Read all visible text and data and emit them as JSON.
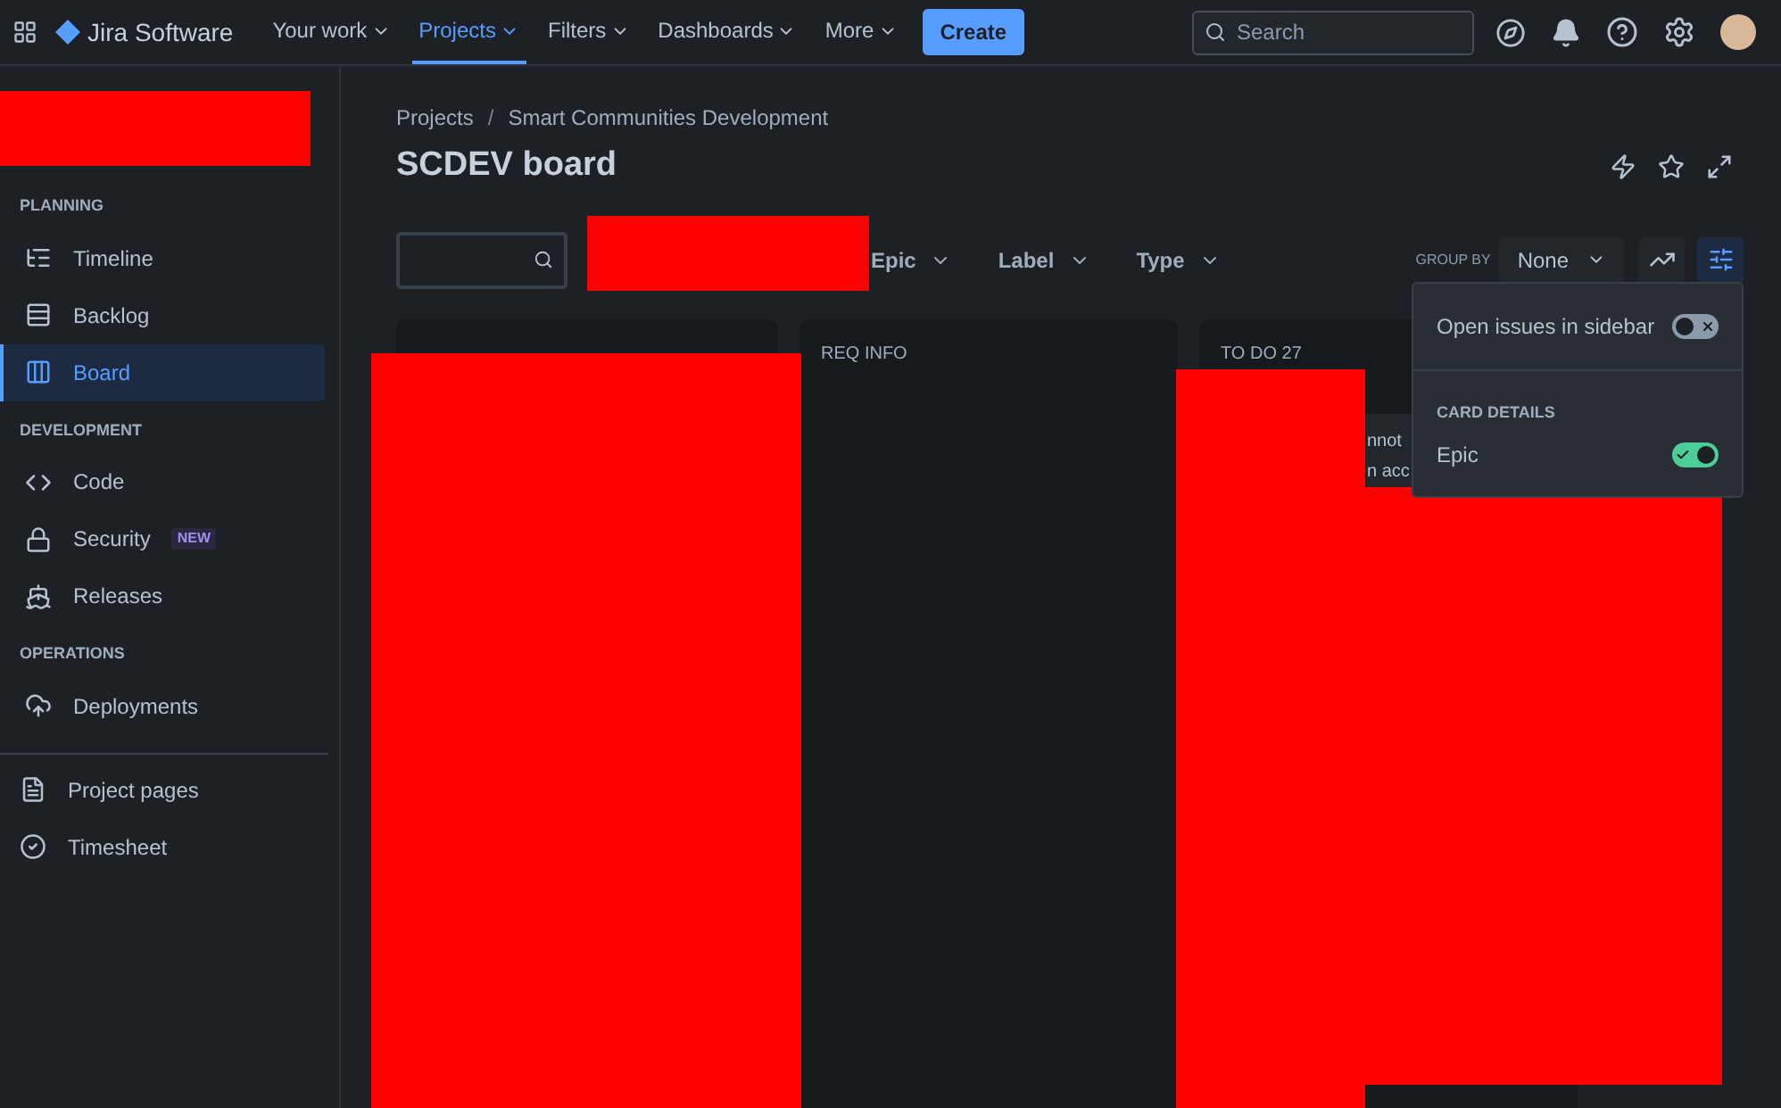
{
  "nav": {
    "product": "Jira Software",
    "items": [
      {
        "label": "Your work",
        "selected": false
      },
      {
        "label": "Projects",
        "selected": true
      },
      {
        "label": "Filters",
        "selected": false
      },
      {
        "label": "Dashboards",
        "selected": false
      },
      {
        "label": "More",
        "selected": false
      }
    ],
    "create": "Create",
    "search": {
      "placeholder": "Search"
    }
  },
  "sidebar": {
    "sections": [
      {
        "title": "PLANNING",
        "items": [
          {
            "label": "Timeline",
            "selected": false
          },
          {
            "label": "Backlog",
            "selected": false
          },
          {
            "label": "Board",
            "selected": true
          }
        ]
      },
      {
        "title": "DEVELOPMENT",
        "items": [
          {
            "label": "Code",
            "selected": false
          },
          {
            "label": "Security",
            "badge": "NEW",
            "selected": false
          },
          {
            "label": "Releases",
            "selected": false
          }
        ]
      },
      {
        "title": "OPERATIONS",
        "items": [
          {
            "label": "Deployments",
            "selected": false
          }
        ]
      }
    ],
    "footer": [
      {
        "label": "Project pages"
      },
      {
        "label": "Timesheet"
      }
    ]
  },
  "breadcrumbs": [
    "Projects",
    "Smart Communities Development"
  ],
  "breadcrumb_separator": "/",
  "title": "SCDEV board",
  "filters": [
    "Epic",
    "Label",
    "Type"
  ],
  "group_by": {
    "label": "GROUP BY",
    "value": "None"
  },
  "columns": [
    {
      "title": "REQ INFO"
    },
    {
      "title": "TO DO 27",
      "card_lines": [
        "nnot",
        "n acc"
      ]
    }
  ],
  "popover": {
    "toggles": [
      {
        "label": "Open issues in sidebar",
        "on": false
      }
    ],
    "section": "CARD DETAILS",
    "details": [
      {
        "label": "Epic",
        "on": true
      }
    ]
  }
}
